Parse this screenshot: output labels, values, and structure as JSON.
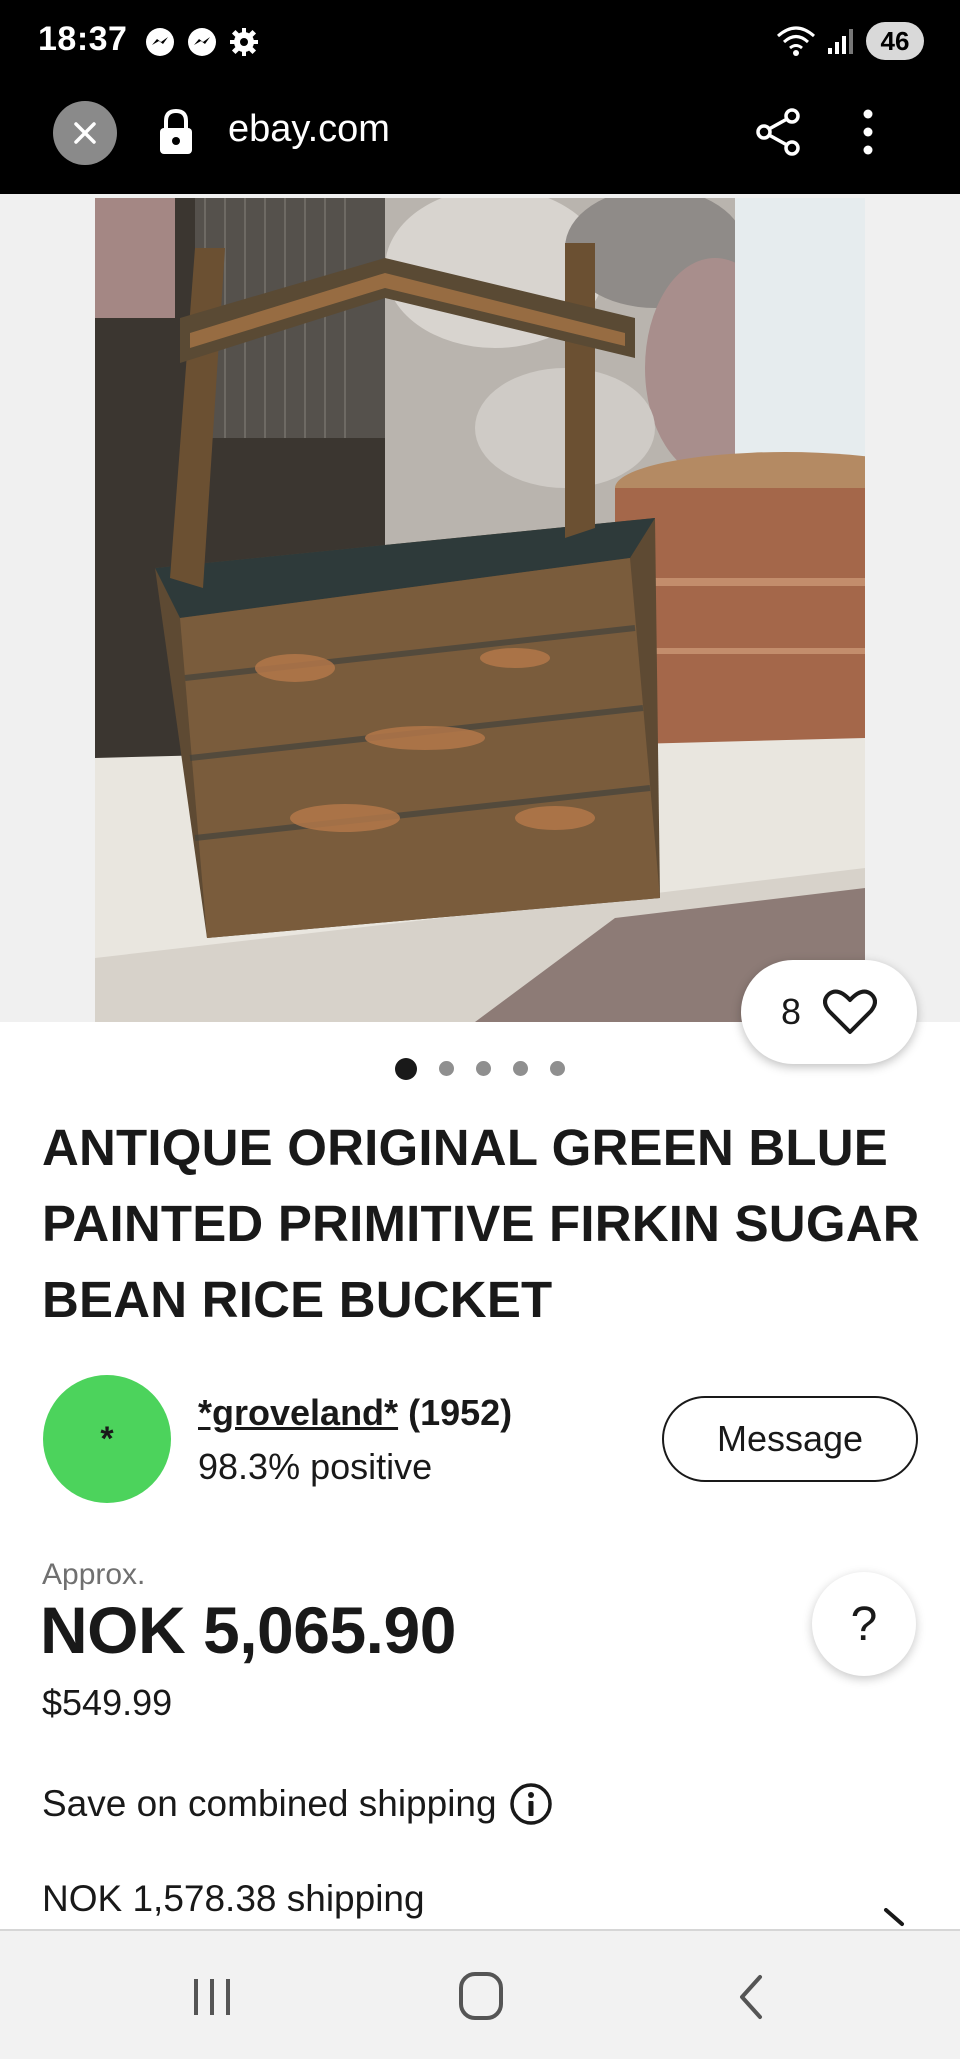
{
  "status_bar": {
    "time": "18:37",
    "left_icons": [
      "messenger-icon",
      "messenger-icon",
      "settings-gear-icon"
    ],
    "right_icons": [
      "wifi-icon",
      "signal-icon"
    ],
    "battery": "46"
  },
  "browser": {
    "url": "ebay.com",
    "icons": [
      "close-icon",
      "lock-icon",
      "share-icon",
      "more-vertical-icon"
    ]
  },
  "gallery": {
    "image_subject": "wooden bucket photo",
    "watch_count": "8",
    "dots_total": 5,
    "dots_active_index": 0
  },
  "listing": {
    "title": "ANTIQUE ORIGINAL GREEN BLUE PAINTED PRIMITIVE FIRKIN SUGAR BEAN RICE BUCKET"
  },
  "seller": {
    "avatar_initial": "*",
    "name": "*groveland*",
    "score": "(1952)",
    "feedback": "98.3% positive",
    "message_label": "Message"
  },
  "price": {
    "approx_label": "Approx.",
    "amount": "NOK 5,065.90",
    "usd": "$549.99",
    "help_label": "?"
  },
  "shipping": {
    "combined_label": "Save on combined shipping",
    "cost": "NOK 1,578.38 shipping"
  },
  "colors": {
    "seller_avatar": "#4cd35c",
    "text": "#191919",
    "muted": "#707070"
  }
}
